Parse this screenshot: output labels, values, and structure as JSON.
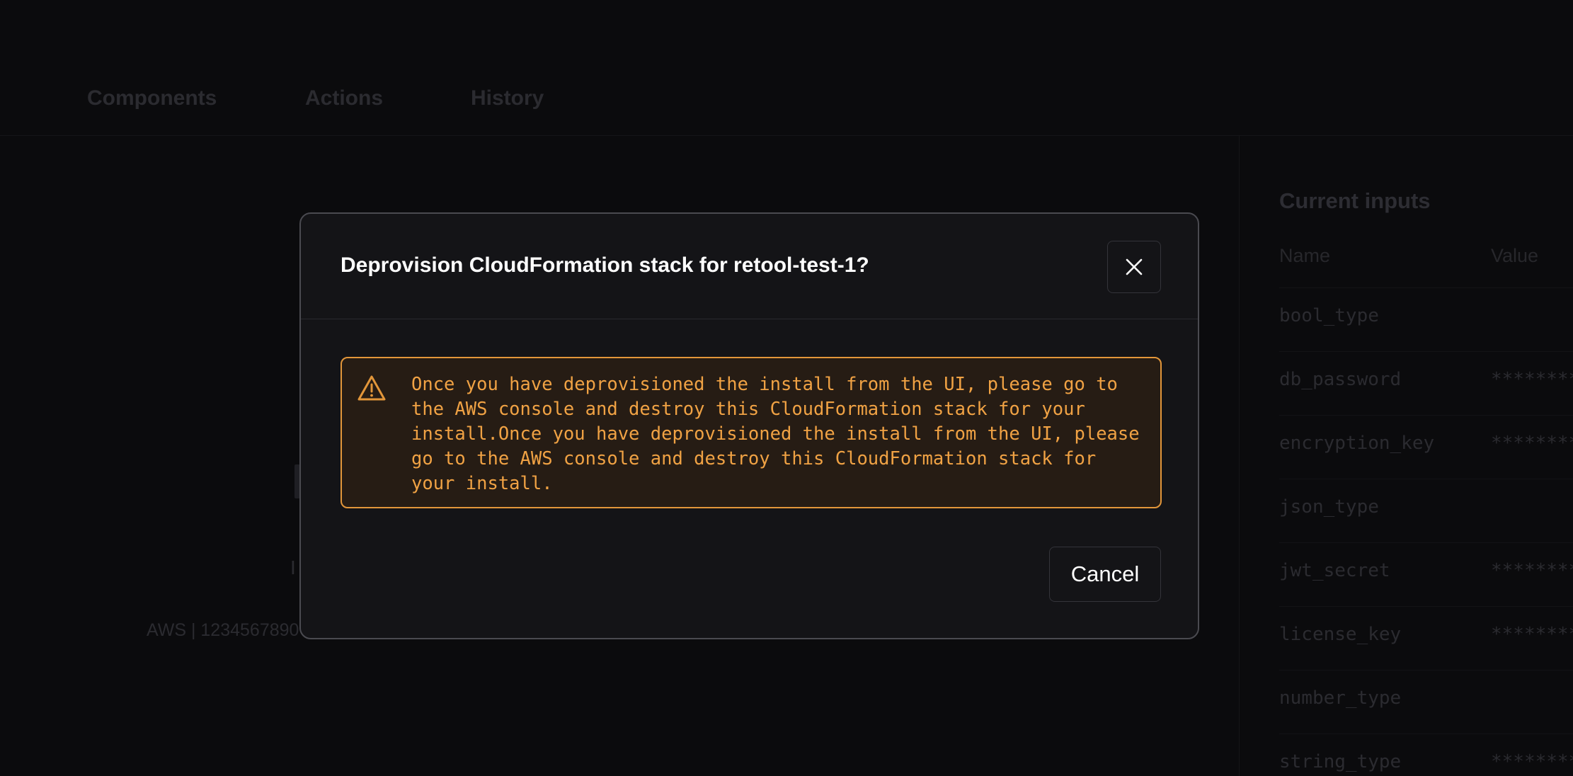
{
  "tabs": {
    "components": "Components",
    "actions": "Actions",
    "history": "History"
  },
  "inputs_panel": {
    "title": "Current inputs",
    "col_name": "Name",
    "col_value": "Value",
    "rows": [
      {
        "name": "bool_type",
        "value": ""
      },
      {
        "name": "db_password",
        "value": "********"
      },
      {
        "name": "encryption_key",
        "value": "********"
      },
      {
        "name": "json_type",
        "value": ""
      },
      {
        "name": "jwt_secret",
        "value": "********"
      },
      {
        "name": "license_key",
        "value": "********"
      },
      {
        "name": "number_type",
        "value": ""
      },
      {
        "name": "string_type",
        "value": "********"
      }
    ]
  },
  "background": {
    "meta": "AWS | 1234567890",
    "fragment": "I"
  },
  "modal": {
    "title": "Deprovision CloudFormation stack for retool-test-1?",
    "alert_text": "Once you have deprovisioned the install from the UI, please go to the AWS console and destroy this CloudFormation stack for your install.Once you have deprovisioned the install from the UI, please go to the AWS console and destroy this CloudFormation stack for your install.",
    "cancel_label": "Cancel",
    "colors": {
      "warning": "#e2963a",
      "warning_bg": "#261c14"
    }
  }
}
